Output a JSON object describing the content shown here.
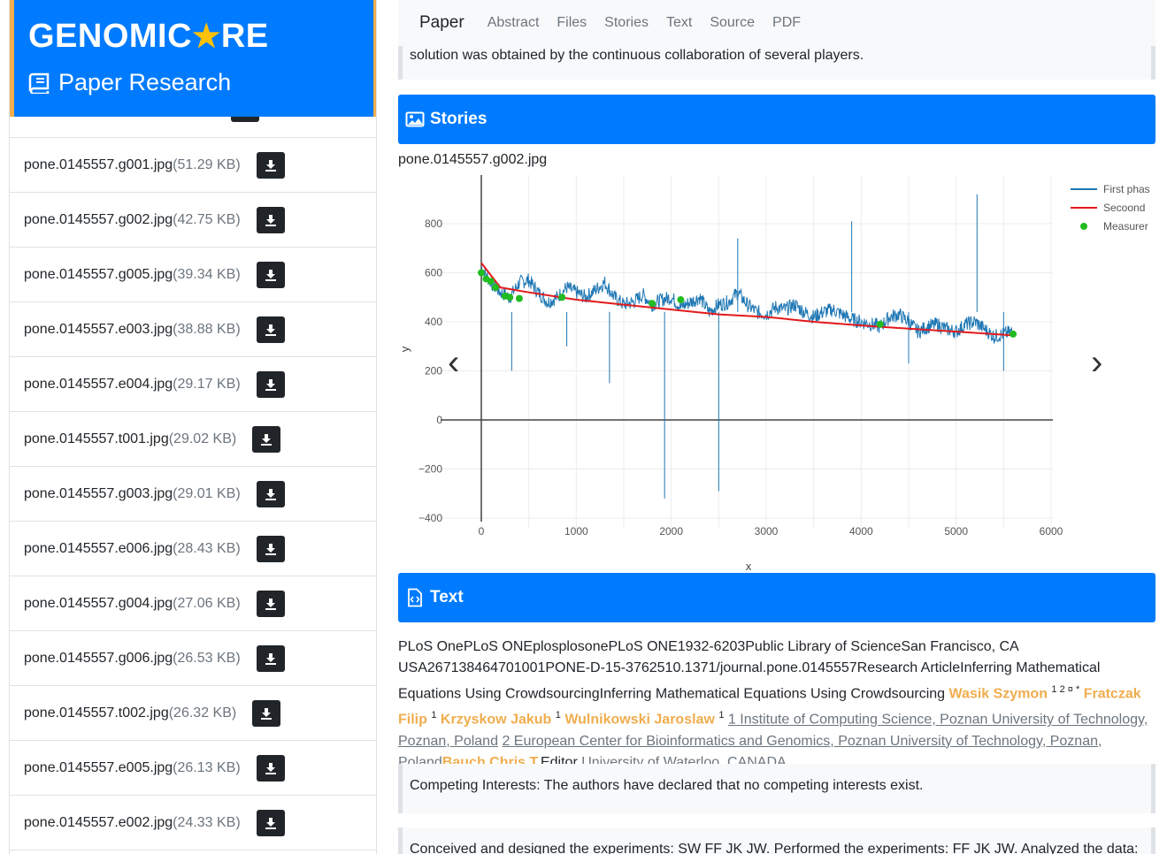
{
  "brand": {
    "title_pre": "GENOMIC",
    "title_post": "RE",
    "star": "★",
    "subtitle": "Paper Research"
  },
  "files": [
    {
      "name": "pone.0145557.g001.jpg",
      "size": "(51.29 KB)"
    },
    {
      "name": "pone.0145557.g002.jpg",
      "size": "(42.75 KB)"
    },
    {
      "name": "pone.0145557.g005.jpg",
      "size": "(39.34 KB)"
    },
    {
      "name": "pone.0145557.e003.jpg",
      "size": "(38.88 KB)"
    },
    {
      "name": "pone.0145557.e004.jpg",
      "size": "(29.17 KB)"
    },
    {
      "name": "pone.0145557.t001.jpg",
      "size": "(29.02 KB)"
    },
    {
      "name": "pone.0145557.g003.jpg",
      "size": "(29.01 KB)"
    },
    {
      "name": "pone.0145557.e006.jpg",
      "size": "(28.43 KB)"
    },
    {
      "name": "pone.0145557.g004.jpg",
      "size": "(27.06 KB)"
    },
    {
      "name": "pone.0145557.g006.jpg",
      "size": "(26.53 KB)"
    },
    {
      "name": "pone.0145557.t002.jpg",
      "size": "(26.32 KB)"
    },
    {
      "name": "pone.0145557.e005.jpg",
      "size": "(26.13 KB)"
    },
    {
      "name": "pone.0145557.e002.jpg",
      "size": "(24.33 KB)"
    }
  ],
  "nav": {
    "brand": "Paper",
    "links": [
      "Abstract",
      "Files",
      "Stories",
      "Text",
      "Source",
      "PDF"
    ]
  },
  "abstract_tail": "solution was obtained by the continuous collaboration of several players.",
  "sections": {
    "stories": "Stories",
    "text": "Text"
  },
  "story": {
    "filename": "pone.0145557.g002.jpg",
    "prev": "‹",
    "next": "›"
  },
  "chart_data": {
    "type": "line",
    "xlabel": "x",
    "ylabel": "y",
    "xlim": [
      -400,
      6000
    ],
    "ylim": [
      -400,
      850
    ],
    "x_ticks": [
      0,
      1000,
      2000,
      3000,
      4000,
      5000,
      6000
    ],
    "y_ticks": [
      -400,
      -200,
      0,
      200,
      400,
      600,
      800
    ],
    "legend_position": "top-right",
    "series": [
      {
        "name": "First phas",
        "color": "#1f77b4",
        "kind": "line",
        "x": [
          0,
          100,
          200,
          300,
          400,
          500,
          600,
          700,
          800,
          900,
          1000,
          1100,
          1200,
          1300,
          1400,
          1500,
          1600,
          1700,
          1800,
          1900,
          2000,
          2100,
          2200,
          2300,
          2400,
          2500,
          2600,
          2700,
          2800,
          2900,
          3000,
          3100,
          3200,
          3300,
          3400,
          3500,
          3600,
          3700,
          3800,
          3900,
          4000,
          4100,
          4200,
          4300,
          4400,
          4500,
          4600,
          4700,
          4800,
          4900,
          5000,
          5100,
          5200,
          5300,
          5400,
          5500,
          5600
        ],
        "y": [
          620,
          560,
          520,
          500,
          560,
          570,
          520,
          480,
          500,
          540,
          520,
          500,
          530,
          560,
          500,
          470,
          480,
          510,
          470,
          490,
          500,
          460,
          480,
          500,
          440,
          470,
          480,
          520,
          470,
          440,
          430,
          460,
          450,
          470,
          440,
          420,
          440,
          450,
          430,
          410,
          400,
          390,
          380,
          420,
          430,
          400,
          360,
          380,
          390,
          370,
          360,
          390,
          400,
          370,
          340,
          350,
          360
        ]
      },
      {
        "name": "Secoond",
        "color": "#e31a1c",
        "kind": "line",
        "x": [
          0,
          200,
          500,
          1000,
          1500,
          2000,
          2500,
          3000,
          3500,
          4000,
          4500,
          5000,
          5600
        ],
        "y": [
          640,
          540,
          520,
          490,
          470,
          450,
          430,
          420,
          400,
          385,
          372,
          360,
          345
        ]
      },
      {
        "name": "Measurer",
        "color": "#22bb22",
        "kind": "marker",
        "x": [
          0,
          50,
          100,
          150,
          250,
          300,
          400,
          850,
          1800,
          2100,
          4200,
          5600
        ],
        "y": [
          600,
          575,
          565,
          540,
          505,
          500,
          495,
          500,
          475,
          490,
          390,
          350
        ]
      }
    ]
  },
  "text": {
    "intro": "PLoS OnePLoS ONEplosplosonePLoS ONE1932-6203Public Library of ScienceSan Francisco, CA USA267138464701001PONE-D-15-3762510.1371/journal.pone.0145557Research ArticleInferring Mathematical Equations Using CrowdsourcingInferring Mathematical Equations Using Crowdsourcing ",
    "author1": "Wasik Szymon",
    "author1_sup": "1 2 ¤ *",
    "author2": "Fratczak Filip",
    "author2_sup": "1",
    "author3": "Krzyskow Jakub",
    "author3_sup": "1",
    "author4": "Wulnikowski Jaroslaw",
    "author4_sup": "1",
    "affil1_num": "1",
    "affil1": "Institute of Computing Science, Poznan University of Technology, Poznan, Poland",
    "affil2_num": "2",
    "affil2": "European Center for Bioinformatics and Genomics, Poznan University of Technology, Poznan, Poland",
    "editor": "Bauch Chris T.",
    "editor_label": "Editor",
    "editor_affil": "University of Waterloo, CANADA",
    "competing": "Competing Interests: The authors have declared that no competing interests exist.",
    "contrib": "Conceived and designed the experiments: SW FF JK JW. Performed the experiments: FF JK JW. Analyzed the data:"
  }
}
